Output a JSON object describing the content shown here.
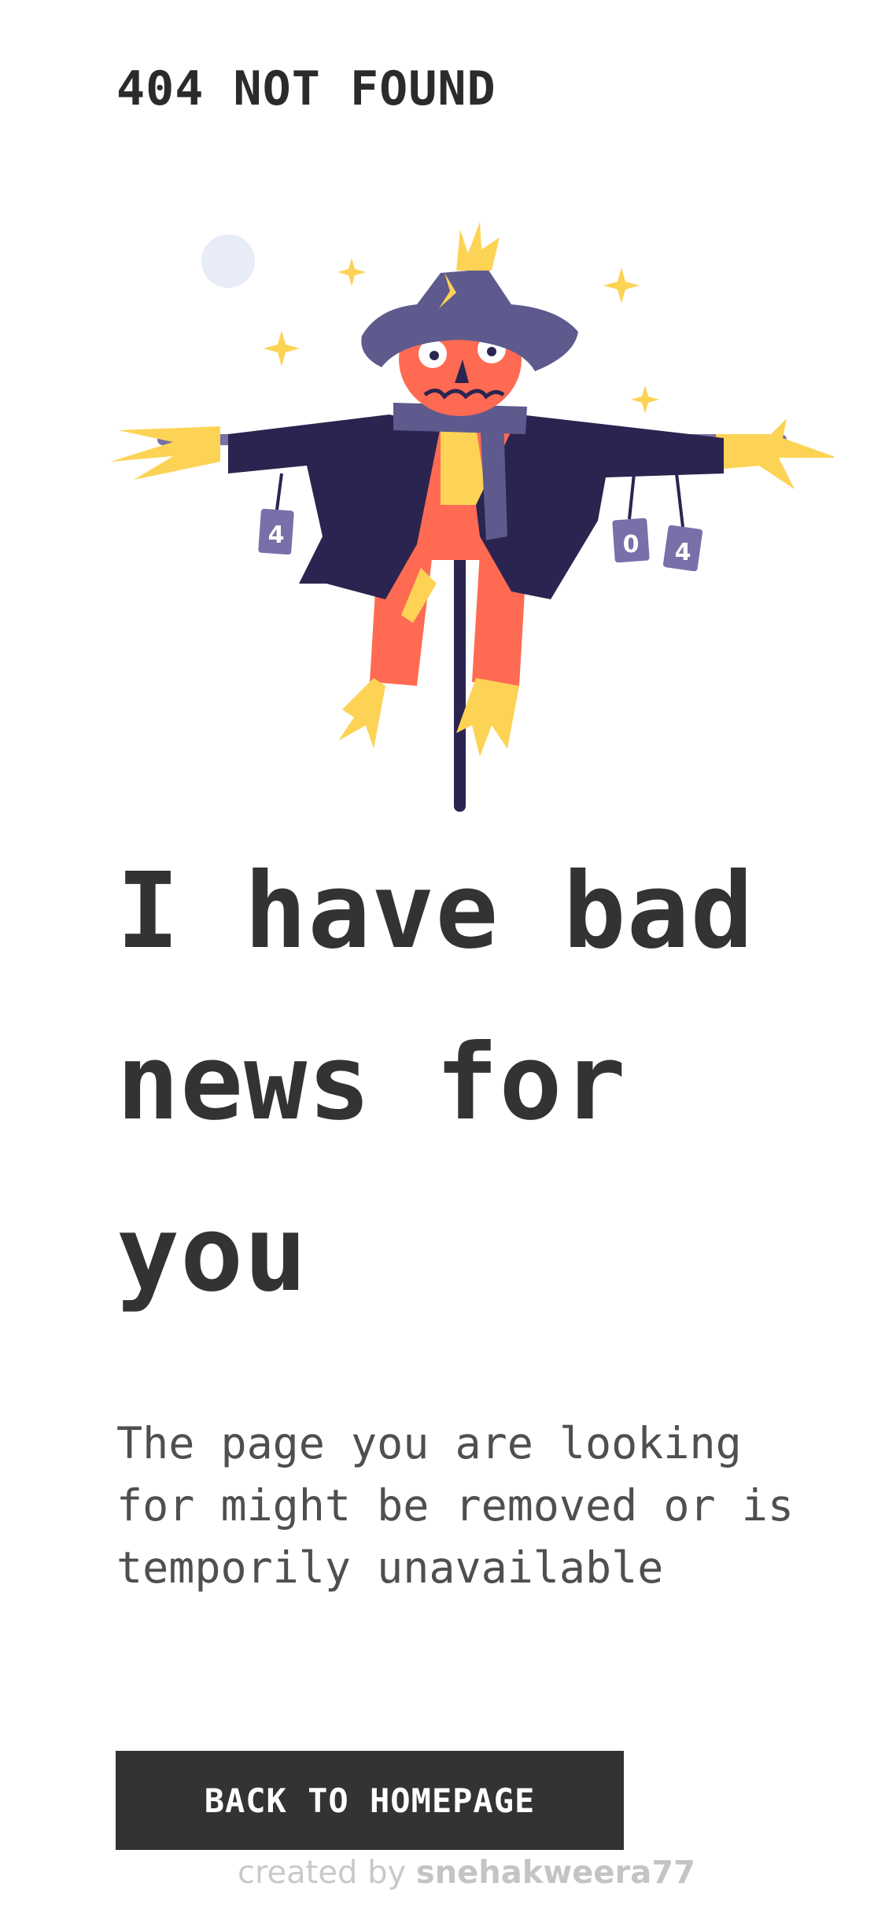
{
  "header": {
    "brand": "404 NOT FOUND"
  },
  "illustration": {
    "icon": "scarecrow-illustration",
    "can_labels": [
      "4",
      "0",
      "4"
    ]
  },
  "main": {
    "headline": "I have bad news for you",
    "description": "The page you are looking for might be removed or is temporily unavailable",
    "cta_label": "BACK TO HOMEPAGE"
  },
  "footer": {
    "credit_prefix": "created by",
    "credit_author": "snehakweera77"
  },
  "colors": {
    "text": "#333333",
    "button_bg": "#333333",
    "button_text": "#ffffff",
    "coat": "#2b2450",
    "hat": "#5e5a8e",
    "pumpkin": "#ff6b52",
    "straw": "#fcd354",
    "moon": "#e8ecf7"
  }
}
